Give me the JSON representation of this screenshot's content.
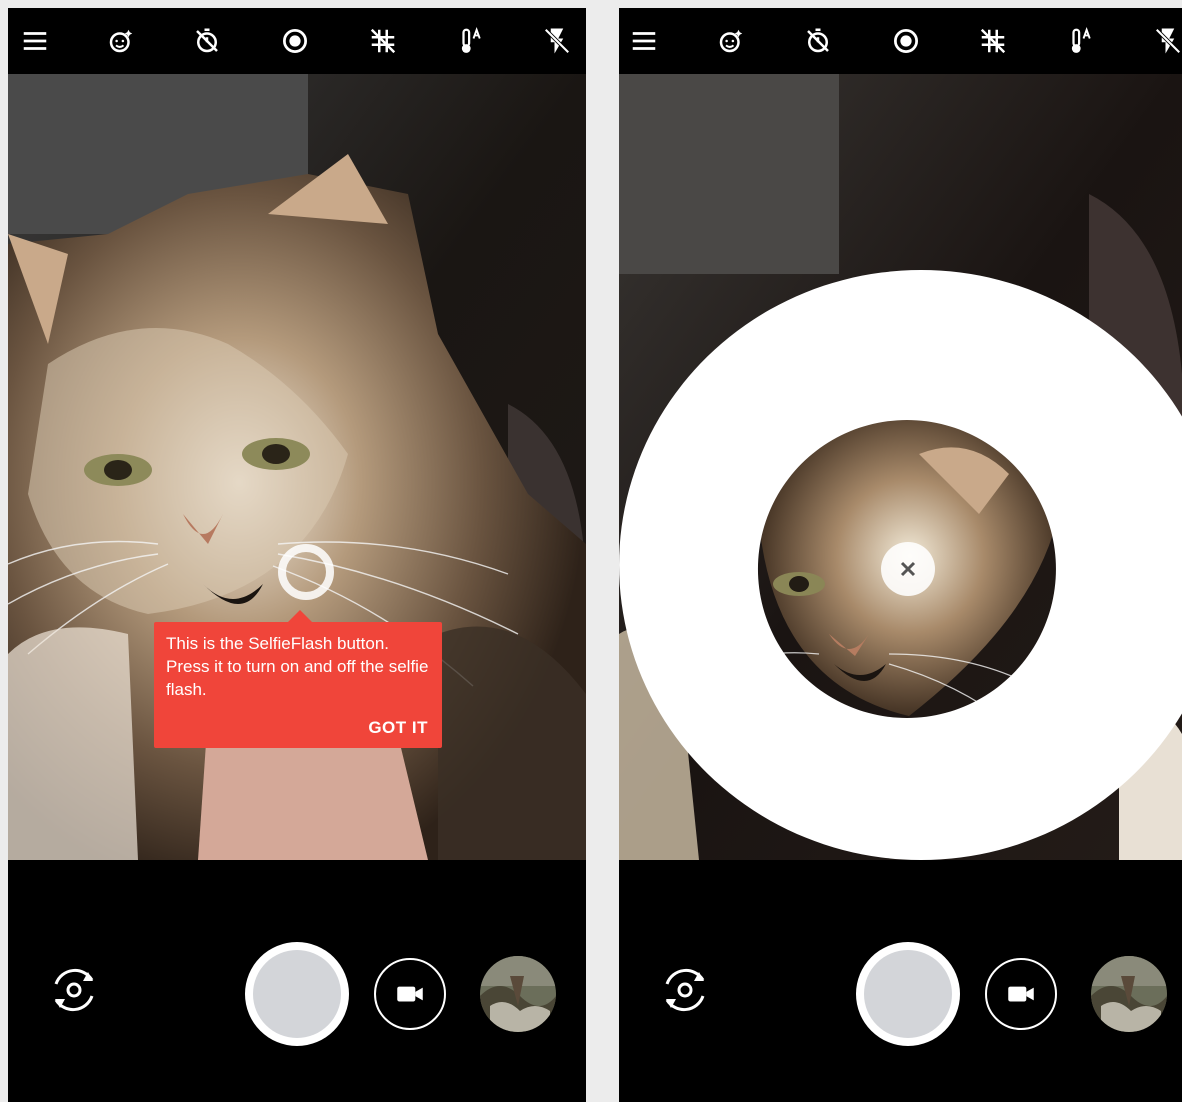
{
  "topbar_icons": [
    "menu-icon",
    "face-retouch-icon",
    "timer-off-icon",
    "selfie-flash-icon",
    "grid-off-icon",
    "white-balance-auto-icon",
    "flash-off-icon"
  ],
  "left_screen": {
    "tooltip": {
      "text": "This is the SelfieFlash button. Press it to turn on and off the selfie flash.",
      "button_label": "GOT IT"
    }
  },
  "bottombar_icons": [
    "switch-camera-icon",
    "shutter-button",
    "video-mode-icon",
    "gallery-thumbnail"
  ],
  "colors": {
    "tooltip_bg": "#f0453a",
    "shutter_inner": "#d3d5d9",
    "bar_bg": "#000000"
  }
}
